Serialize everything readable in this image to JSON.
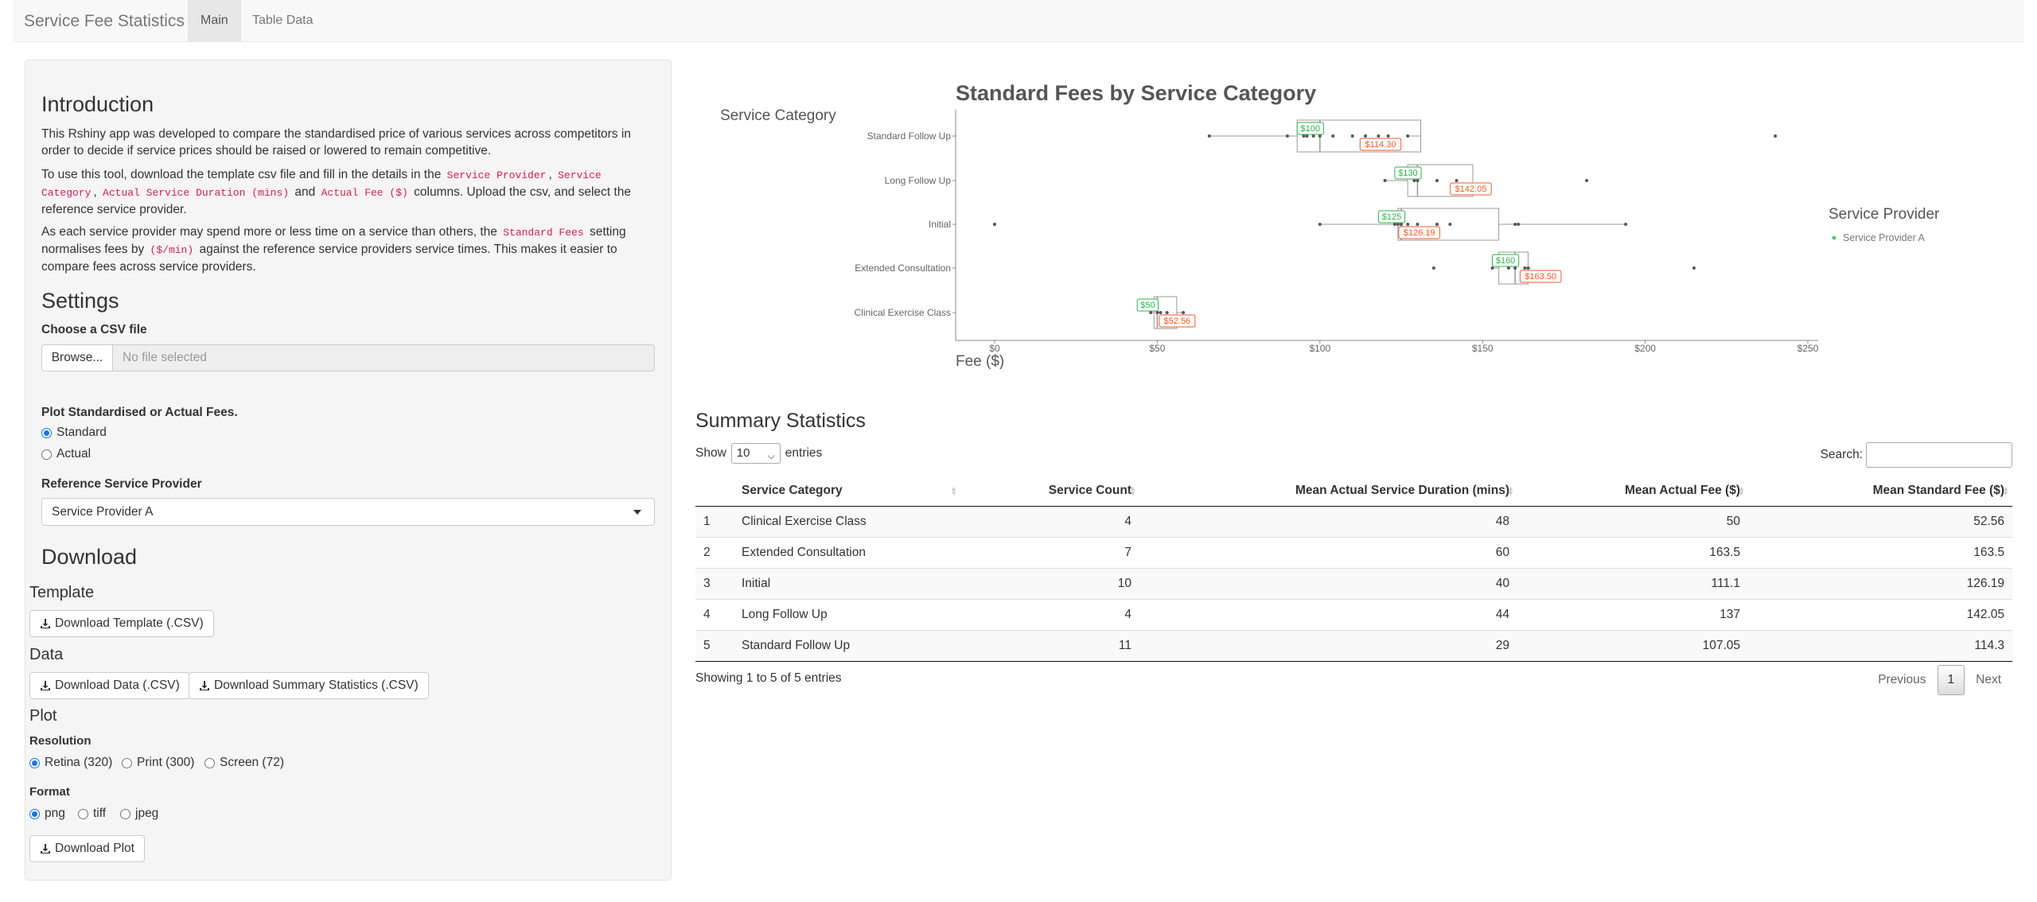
{
  "app": {
    "brand": "Service Fee Statistics",
    "tabs": [
      {
        "label": "Main",
        "active": true
      },
      {
        "label": "Table Data",
        "active": false
      }
    ]
  },
  "sidebar": {
    "intro_title": "Introduction",
    "intro_p1": "This Rshiny app was developed to compare the standardised price of various services across competitors in order to decide if service prices should be raised or lowered to remain competitive.",
    "intro_p2_a": "To use this tool, download the template csv file and fill in the details in the",
    "intro_p2_code1": "Service Provider",
    "intro_p2_code2": "Service Category",
    "intro_p2_code3": "Actual Service Duration (mins)",
    "intro_p2_and": "and",
    "intro_p2_code4": "Actual Fee ($)",
    "intro_p2_b": "columns. Upload the csv, and select the reference service provider.",
    "intro_p3_a": "As each service provider may spend more or less time on a service than others, the",
    "intro_p3_code1": "Standard Fees",
    "intro_p3_b": "setting normalises fees by",
    "intro_p3_code2": "($/min)",
    "intro_p3_c": "against the reference service providers service times. This makes it easier to compare fees across service providers.",
    "settings_title": "Settings",
    "csv_label": "Choose a CSV file",
    "browse_label": "Browse...",
    "file_placeholder": "No file selected",
    "plot_type_label": "Plot Standardised or Actual Fees.",
    "plot_type_options": [
      {
        "label": "Standard",
        "selected": true
      },
      {
        "label": "Actual",
        "selected": false
      }
    ],
    "ref_label": "Reference Service Provider",
    "ref_value": "Service Provider A",
    "download_title": "Download",
    "template_title": "Template",
    "template_btn": "Download Template (.CSV)",
    "data_title": "Data",
    "data_btn": "Download Data (.CSV)",
    "summary_btn": "Download Summary Statistics (.CSV)",
    "plot_title": "Plot",
    "resolution_label": "Resolution",
    "resolution_options": [
      {
        "label": "Retina (320)",
        "selected": true
      },
      {
        "label": "Print (300)",
        "selected": false
      },
      {
        "label": "Screen (72)",
        "selected": false
      }
    ],
    "format_label": "Format",
    "format_options": [
      {
        "label": "png",
        "selected": true
      },
      {
        "label": "tiff",
        "selected": false
      },
      {
        "label": "jpeg",
        "selected": false
      }
    ],
    "plot_btn": "Download Plot"
  },
  "chart_data": {
    "type": "boxplot",
    "title": "Standard Fees by Service Category",
    "ylabel": "Service Category",
    "xlabel": "Fee ($)",
    "xlim": [
      0,
      250
    ],
    "x_ticks": [
      0,
      50,
      100,
      150,
      200,
      250
    ],
    "x_tick_labels": [
      "$0",
      "$50",
      "$100",
      "$150",
      "$200",
      "$250"
    ],
    "legend_title": "Service Provider",
    "legend": [
      {
        "name": "Service Provider A",
        "color": "#55c667"
      }
    ],
    "median_color": "#2bb34a",
    "mean_color": "#f05a28",
    "categories": [
      {
        "name": "Standard Follow Up",
        "whisker_low": 66,
        "q1": 93,
        "median": 100,
        "q3": 131,
        "whisker_high": 127,
        "median_label": "$100",
        "mean": 114.3,
        "mean_label": "$114.30",
        "points": [
          66,
          90,
          95,
          96,
          98,
          100,
          104,
          110,
          114,
          118,
          121,
          127,
          240
        ]
      },
      {
        "name": "Long Follow Up",
        "whisker_low": 120,
        "q1": 127,
        "median": 130,
        "q3": 147,
        "whisker_high": 147,
        "median_label": "$130",
        "mean": 142.05,
        "mean_label": "$142.05",
        "points": [
          120,
          129,
          130,
          136,
          142,
          182
        ]
      },
      {
        "name": "Initial",
        "whisker_low": 100,
        "q1": 124,
        "median": 125,
        "q3": 155,
        "whisker_high": 194,
        "median_label": "$125",
        "mean": 126.19,
        "mean_label": "$126.19",
        "points": [
          0,
          100,
          123,
          124,
          125,
          127,
          130,
          136,
          140,
          160,
          161,
          194
        ]
      },
      {
        "name": "Extended Consultation",
        "whisker_low": 153,
        "q1": 155,
        "median": 160,
        "q3": 164,
        "whisker_high": 165,
        "median_label": "$160",
        "mean": 163.5,
        "mean_label": "$163.50",
        "points": [
          135,
          153,
          158,
          160,
          163,
          164,
          215
        ]
      },
      {
        "name": "Clinical Exercise Class",
        "whisker_low": 48,
        "q1": 49,
        "median": 50,
        "q3": 56,
        "whisker_high": 58,
        "median_label": "$50",
        "mean": 52.56,
        "mean_label": "$52.56",
        "points": [
          48,
          50,
          51,
          53,
          58
        ]
      }
    ]
  },
  "summary": {
    "title": "Summary Statistics",
    "show_label": "Show",
    "entries_value": "10",
    "entries_label": "entries",
    "search_label": "Search:",
    "columns": [
      "",
      "Service Category",
      "Service Count",
      "Mean Actual Service Duration (mins)",
      "Mean Actual Fee ($)",
      "Mean Standard Fee ($)"
    ],
    "rows": [
      [
        "1",
        "Clinical Exercise Class",
        "4",
        "48",
        "50",
        "52.56"
      ],
      [
        "2",
        "Extended Consultation",
        "7",
        "60",
        "163.5",
        "163.5"
      ],
      [
        "3",
        "Initial",
        "10",
        "40",
        "111.1",
        "126.19"
      ],
      [
        "4",
        "Long Follow Up",
        "4",
        "44",
        "137",
        "142.05"
      ],
      [
        "5",
        "Standard Follow Up",
        "11",
        "29",
        "107.05",
        "114.3"
      ]
    ],
    "info": "Showing 1 to 5 of 5 entries",
    "prev_label": "Previous",
    "page_label": "1",
    "next_label": "Next"
  }
}
